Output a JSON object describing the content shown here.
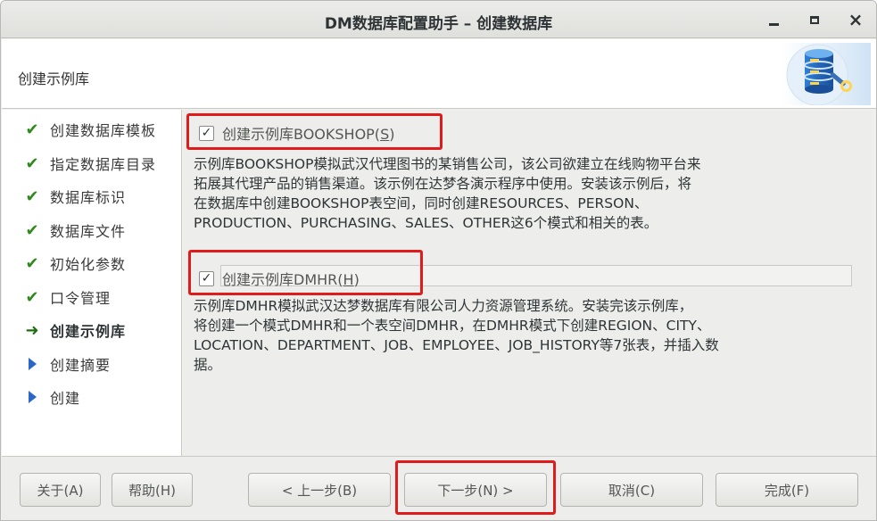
{
  "window": {
    "title": "DM数据库配置助手 – 创建数据库",
    "controls": {
      "minimize": "minimize",
      "maximize": "maximize",
      "close": "×"
    }
  },
  "header": {
    "title": "创建示例库",
    "icon": "database-wrench-icon"
  },
  "nav": {
    "items": [
      {
        "label": "创建数据库模板",
        "state": "done"
      },
      {
        "label": "指定数据库目录",
        "state": "done"
      },
      {
        "label": "数据库标识",
        "state": "done"
      },
      {
        "label": "数据库文件",
        "state": "done"
      },
      {
        "label": "初始化参数",
        "state": "done"
      },
      {
        "label": "口令管理",
        "state": "done"
      },
      {
        "label": "创建示例库",
        "state": "current"
      },
      {
        "label": "创建摘要",
        "state": "pending"
      },
      {
        "label": "创建",
        "state": "pending"
      }
    ]
  },
  "options": {
    "bookshop": {
      "checked": true,
      "label_prefix": "创建示例库BOOKSHOP(",
      "mnemonic": "S",
      "label_suffix": ")",
      "description": [
        "示例库BOOKSHOP模拟武汉代理图书的某销售公司，该公司欲建立在线购物平台来",
        "拓展其代理产品的销售渠道。该示例在达梦各演示程序中使用。安装该示例后，将",
        "在数据库中创建BOOKSHOP表空间，同时创建RESOURCES、PERSON、",
        "PRODUCTION、PURCHASING、SALES、OTHER这6个模式和相关的表。"
      ]
    },
    "dmhr": {
      "checked": true,
      "label_prefix": "创建示例库DMHR(",
      "mnemonic": "H",
      "label_suffix": ")",
      "description": [
        "示例库DMHR模拟武汉达梦数据库有限公司人力资源管理系统。安装完该示例库，",
        "将创建一个模式DMHR和一个表空间DMHR，在DMHR模式下创建REGION、CITY、",
        "LOCATION、DEPARTMENT、JOB、EMPLOYEE、JOB_HISTORY等7张表，并插入数",
        "据。"
      ]
    }
  },
  "footer": {
    "about": "关于(A)",
    "help": "帮助(H)",
    "prev": "< 上一步(B)",
    "next": "下一步(N) >",
    "cancel": "取消(C)",
    "finish": "完成(F)"
  },
  "colors": {
    "highlight": "#e01b1b",
    "check": "#2e8b1a",
    "pending": "#2a67c7"
  }
}
